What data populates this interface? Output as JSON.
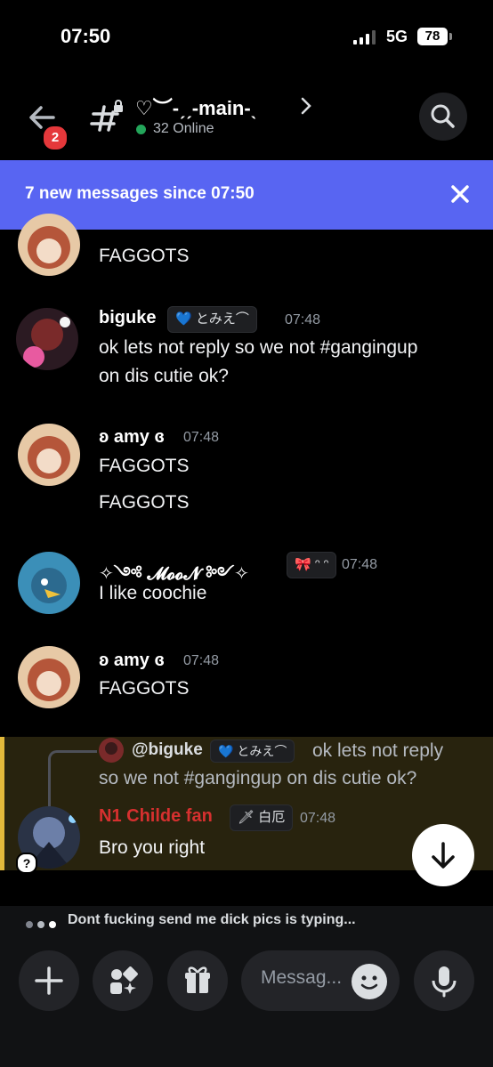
{
  "status_bar": {
    "time": "07:50",
    "network": "5G",
    "battery": "78"
  },
  "header": {
    "back_badge": "2",
    "channel_name": "♡︶-ˏˏ-main-ˎ",
    "online_text": "32 Online"
  },
  "banner": {
    "text": "7 new messages since 07:50"
  },
  "messages": [
    {
      "author": "ʚ amy ɞ",
      "time": "07:48",
      "lines": [
        "FAGGOTS"
      ]
    },
    {
      "author": "biguke",
      "tag": "💙 とみえ⌒",
      "time": "07:48",
      "lines": [
        "ok lets not reply so we not #gangingup",
        "on dis cutie ok?"
      ]
    },
    {
      "author": "ʚ amy ɞ",
      "time": "07:48",
      "lines": [
        "FAGGOTS",
        "FAGGOTS"
      ]
    },
    {
      "author": "✧༺ 𝓜𝓸𝓸𝓝 ༻✧",
      "tag": "🎀 ᵔ ᵔ",
      "time": "07:48",
      "lines": [
        "I like coochie"
      ]
    },
    {
      "author": "ʚ amy ɞ",
      "time": "07:48",
      "lines": [
        "FAGGOTS"
      ]
    },
    {
      "reply_to": {
        "author": "@biguke",
        "tag": "💙 とみえ⌒",
        "text_line1": "ok lets not reply",
        "text_line2": "so we not #gangingup on dis cutie ok?"
      },
      "author": "N1 Childe fan",
      "tag": "🗡 白厄",
      "time": "07:48",
      "lines": [
        "Bro you right"
      ]
    }
  ],
  "typing": {
    "text": "Dont fucking send me dick pics is typing..."
  },
  "composer": {
    "placeholder": "Messag..."
  },
  "colors": {
    "blurple": "#5865f2",
    "online": "#23a55a",
    "reply_highlight": "#28230e",
    "reply_bar": "#e2b93b",
    "red_name": "#d6302f"
  }
}
